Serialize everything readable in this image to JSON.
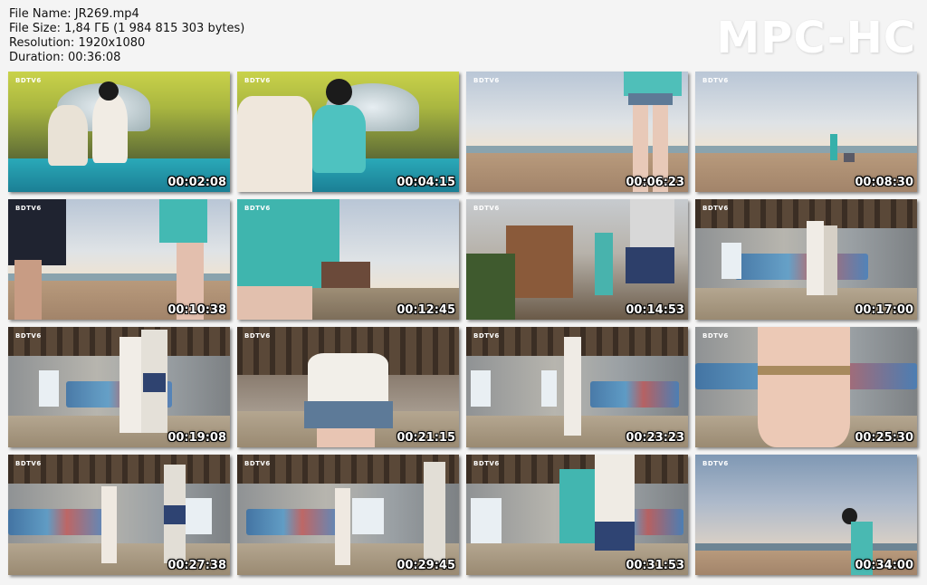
{
  "file_info": {
    "name_line": "File Name: JR269.mp4",
    "size_line": "File Size: 1,84 ГБ (1 984 815 303 bytes)",
    "resolution_line": "Resolution: 1920x1080",
    "duration_line": "Duration: 00:36:08"
  },
  "logo": "MPC-HC",
  "colors": {
    "background": "#f4f4f4",
    "timestamp_text": "#ffffff",
    "timestamp_outline": "#000000"
  },
  "thumbnails": [
    {
      "time": "00:02:08",
      "channel": "BDTV6",
      "scene": "tent"
    },
    {
      "time": "00:04:15",
      "channel": "BDTV6",
      "scene": "tent"
    },
    {
      "time": "00:06:23",
      "channel": "BDTV6",
      "scene": "beach"
    },
    {
      "time": "00:08:30",
      "channel": "BDTV6",
      "scene": "beach"
    },
    {
      "time": "00:10:38",
      "channel": "BDTV6",
      "scene": "beach"
    },
    {
      "time": "00:12:45",
      "channel": "BDTV6",
      "scene": "beach"
    },
    {
      "time": "00:14:53",
      "channel": "BDTV6",
      "scene": "ruin-outside"
    },
    {
      "time": "00:17:00",
      "channel": "BDTV6",
      "scene": "ruin"
    },
    {
      "time": "00:19:08",
      "channel": "BDTV6",
      "scene": "ruin"
    },
    {
      "time": "00:21:15",
      "channel": "BDTV6",
      "scene": "ruin"
    },
    {
      "time": "00:23:23",
      "channel": "BDTV6",
      "scene": "ruin"
    },
    {
      "time": "00:25:30",
      "channel": "BDTV6",
      "scene": "ruin"
    },
    {
      "time": "00:27:38",
      "channel": "BDTV6",
      "scene": "ruin"
    },
    {
      "time": "00:29:45",
      "channel": "BDTV6",
      "scene": "ruin"
    },
    {
      "time": "00:31:53",
      "channel": "BDTV6",
      "scene": "ruin"
    },
    {
      "time": "00:34:00",
      "channel": "BDTV6",
      "scene": "beach"
    }
  ]
}
